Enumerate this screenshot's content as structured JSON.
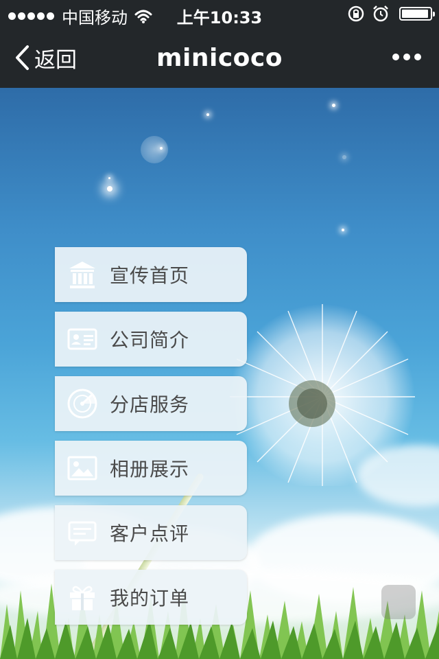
{
  "status_bar": {
    "carrier": "中国移动",
    "time": "上午10:33",
    "signal_bars": 5,
    "battery_level": 0.95
  },
  "nav_bar": {
    "back_label": "返回",
    "title": "minicoco"
  },
  "menu": {
    "items": [
      {
        "label": "宣传首页",
        "icon": "bank-icon"
      },
      {
        "label": "公司简介",
        "icon": "id-card-icon"
      },
      {
        "label": "分店服务",
        "icon": "radar-icon"
      },
      {
        "label": "相册展示",
        "icon": "picture-icon"
      },
      {
        "label": "客户点评",
        "icon": "comment-icon"
      },
      {
        "label": "我的订单",
        "icon": "gift-icon"
      }
    ]
  },
  "colors": {
    "bar_background": "#23272a",
    "menu_background": "#ecf3f8",
    "menu_text": "#4a4a4a",
    "sky_top": "#2e6ca8"
  }
}
